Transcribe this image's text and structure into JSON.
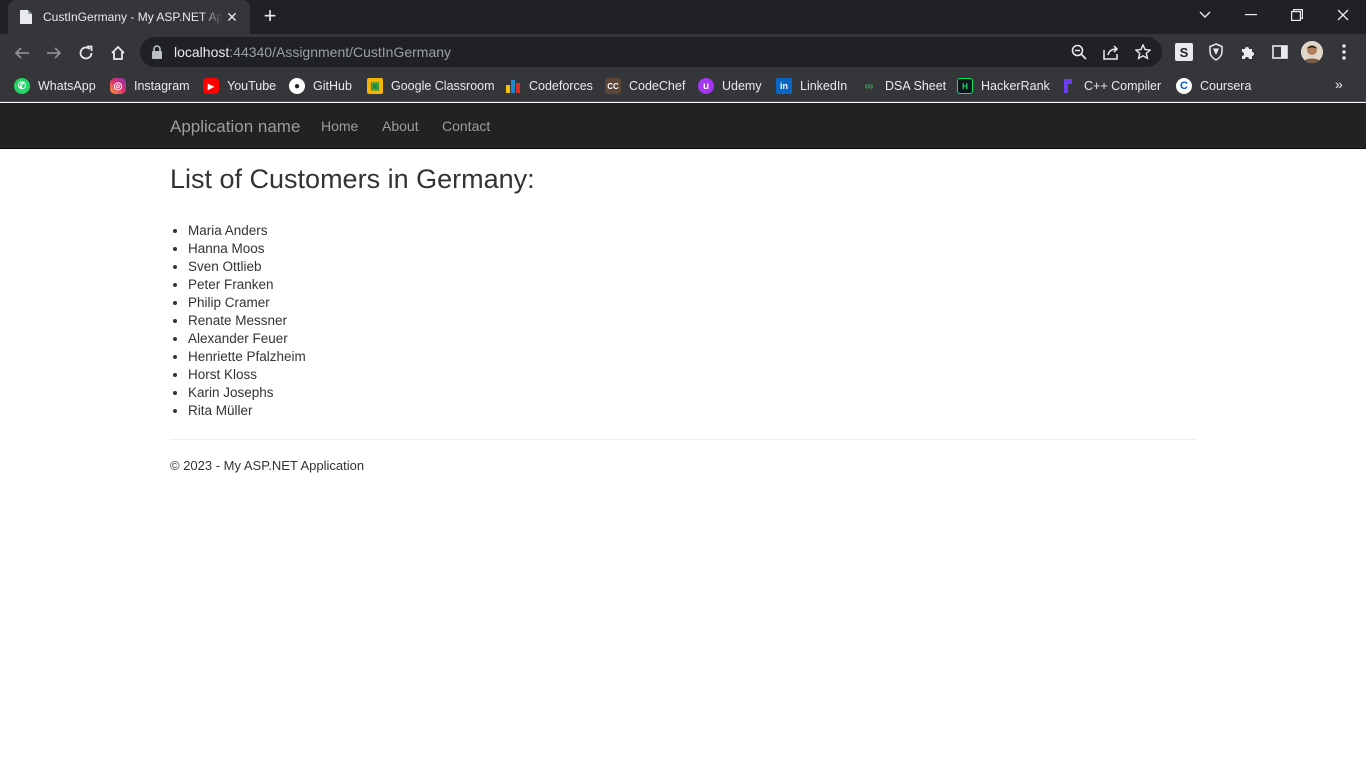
{
  "browser": {
    "tab_title": "CustInGermany - My ASP.NET Application",
    "url_host": "localhost",
    "url_rest": ":44340/Assignment/CustInGermany",
    "new_tab_symbol": "+",
    "close_symbol": "✕",
    "bookmarks": [
      {
        "label": "WhatsApp",
        "icon": "whatsapp-icon",
        "color": "#25d366"
      },
      {
        "label": "Instagram",
        "icon": "instagram-icon",
        "color": "#e1306c"
      },
      {
        "label": "YouTube",
        "icon": "youtube-icon",
        "color": "#ff0000"
      },
      {
        "label": "GitHub",
        "icon": "github-icon",
        "color": "#ffffff"
      },
      {
        "label": "Google Classroom",
        "icon": "google-classroom-icon",
        "color": "#f4b400"
      },
      {
        "label": "Codeforces",
        "icon": "codeforces-icon",
        "color": "#1f8acb"
      },
      {
        "label": "CodeChef",
        "icon": "codechef-icon",
        "color": "#5b4638"
      },
      {
        "label": "Udemy",
        "icon": "udemy-icon",
        "color": "#a435f0"
      },
      {
        "label": "LinkedIn",
        "icon": "linkedin-icon",
        "color": "#0a66c2"
      },
      {
        "label": "DSA Sheet",
        "icon": "dsa-sheet-icon",
        "color": "#2e7d32"
      },
      {
        "label": "HackerRank",
        "icon": "hackerrank-icon",
        "color": "#00ea64"
      },
      {
        "label": "C++ Compiler",
        "icon": "cpp-compiler-icon",
        "color": "#6c3cf5"
      },
      {
        "label": "Coursera",
        "icon": "coursera-icon",
        "color": "#0056d2"
      }
    ]
  },
  "nav": {
    "brand": "Application name",
    "links": [
      "Home",
      "About",
      "Contact"
    ]
  },
  "main": {
    "heading": "List of Customers in Germany:",
    "customers": [
      "Maria Anders",
      "Hanna Moos",
      "Sven Ottlieb",
      "Peter Franken",
      "Philip Cramer",
      "Renate Messner",
      "Alexander Feuer",
      "Henriette Pfalzheim",
      "Horst Kloss",
      "Karin Josephs",
      "Rita Müller"
    ]
  },
  "footer": {
    "text": "© 2023 - My ASP.NET Application"
  }
}
